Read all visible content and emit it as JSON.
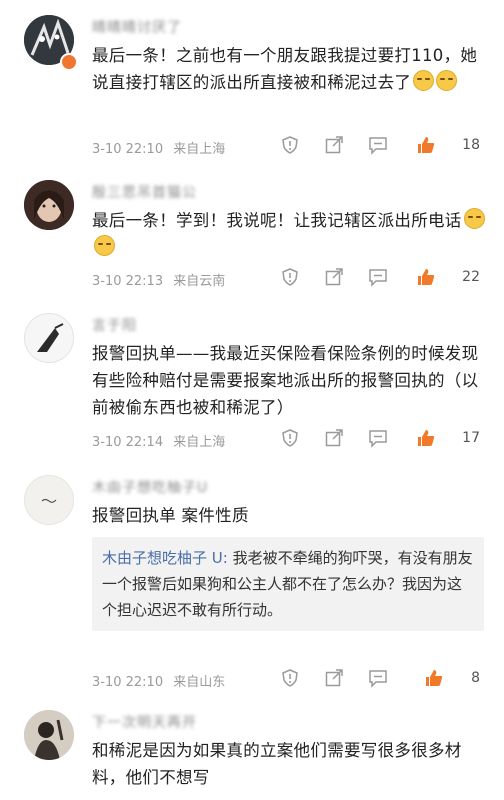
{
  "comments": [
    {
      "username": "晴晴晴讨厌了",
      "text": "最后一条！之前也有一个朋友跟我提过要打110，她说直接打辖区的派出所直接被和稀泥过去了",
      "emoji": "grin-emoji",
      "time": "3-10 22:10",
      "location": "来自上海",
      "likes": "18"
    },
    {
      "username": "殷三思吊首猫公",
      "text": "最后一条！学到！我说呢！让我记辖区派出所电话",
      "emoji": "grin-emoji",
      "time": "3-10 22:13",
      "location": "来自云南",
      "likes": "22"
    },
    {
      "username": "言于阳",
      "text": "报警回执单——我最近买保险看保险条例的时候发现有些险种赔付是需要报案地派出所的报警回执的（以前被偷东西也被和稀泥了）",
      "time": "3-10 22:14",
      "location": "来自上海",
      "likes": "17"
    },
    {
      "username": "木由子想吃柚子U",
      "text": "报警回执单 案件性质",
      "reply_user": "木由子想吃柚子 U:",
      "reply_text": " 我老被不牵绳的狗吓哭，有没有朋友一个报警后如果狗和公主人都不在了怎么办？我因为这个担心迟迟不敢有所行动。",
      "time": "3-10 22:10",
      "location": "来自山东",
      "likes": "8"
    },
    {
      "username": "下一次明天再开",
      "text": "和稀泥是因为如果真的立案他们需要写很多很多材料，他们不想写"
    }
  ],
  "colors": {
    "like_orange": "#f07a2a",
    "icon_gray": "#9a9a9a"
  }
}
